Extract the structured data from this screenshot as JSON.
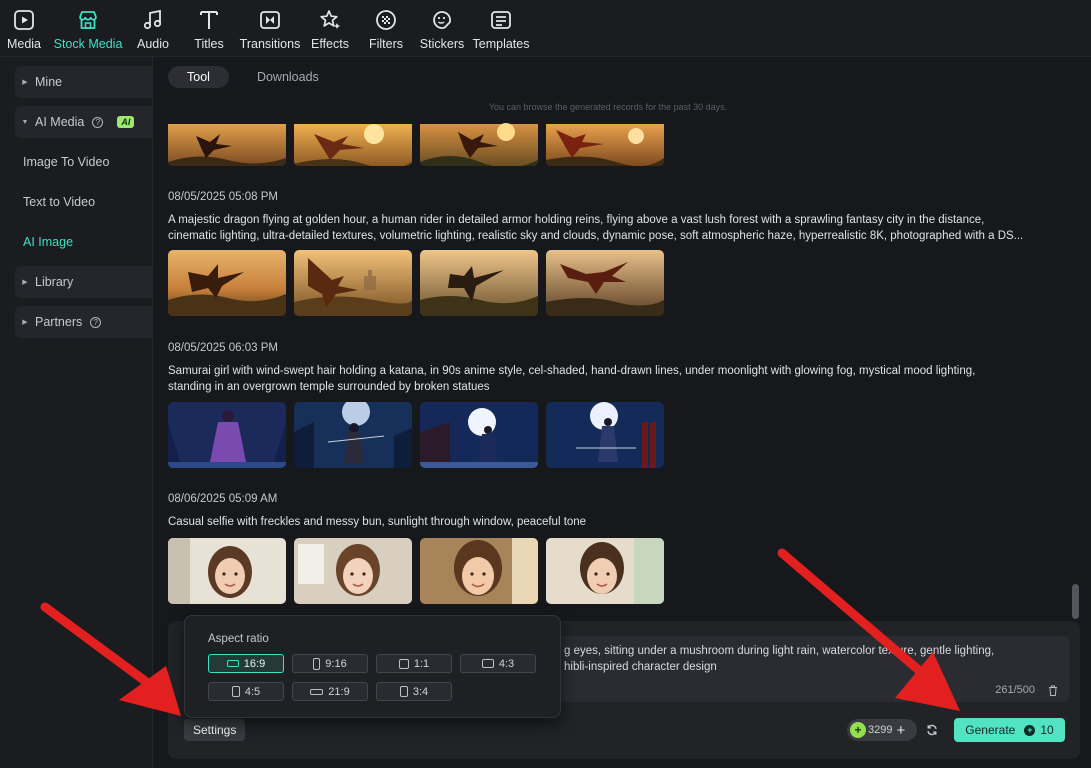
{
  "toolbar": {
    "items": [
      {
        "label": "Media",
        "icon": "media-icon"
      },
      {
        "label": "Stock Media",
        "icon": "stock-media-icon",
        "active": true
      },
      {
        "label": "Audio",
        "icon": "music-note-icon"
      },
      {
        "label": "Titles",
        "icon": "text-t-icon"
      },
      {
        "label": "Transitions",
        "icon": "transitions-icon"
      },
      {
        "label": "Effects",
        "icon": "effects-star-icon"
      },
      {
        "label": "Filters",
        "icon": "filters-icon"
      },
      {
        "label": "Stickers",
        "icon": "sticker-icon"
      },
      {
        "label": "Templates",
        "icon": "templates-icon"
      }
    ]
  },
  "sidebar": {
    "items": [
      {
        "label": "Mine"
      },
      {
        "label": "AI Media",
        "badge": "AI"
      },
      {
        "label": "Image To Video"
      },
      {
        "label": "Text to Video"
      },
      {
        "label": "AI Image"
      },
      {
        "label": "Library"
      },
      {
        "label": "Partners"
      }
    ]
  },
  "tabs": {
    "tool": "Tool",
    "downloads": "Downloads"
  },
  "hint": "You can browse the generated records for the past 30 days.",
  "records": [
    {
      "timestamp": "08/05/2025 05:08 PM",
      "prompt_line1": "A majestic dragon flying at golden hour, a human rider in detailed armor holding reins, flying above a vast lush forest with a sprawling fantasy city in the distance,",
      "prompt_line2": "cinematic lighting, ultra-detailed textures, volumetric lighting, realistic sky and clouds, dynamic pose, soft atmospheric haze, hyperrealistic 8K, photographed with a DS..."
    },
    {
      "timestamp": "08/05/2025 06:03 PM",
      "prompt_line1": "Samurai girl with wind-swept hair holding a katana, in 90s anime style, cel-shaded, hand-drawn lines, under moonlight with glowing fog, mystical mood lighting,",
      "prompt_line2": "standing in an overgrown temple surrounded by broken statues"
    },
    {
      "timestamp": "08/06/2025 05:09 AM",
      "prompt_line1": "Casual selfie with freckles and messy bun, sunlight through window, peaceful tone",
      "prompt_line2": ""
    }
  ],
  "composer": {
    "text_line1": "g eyes, sitting under a mushroom during light rain, watercolor texture, gentle lighting,",
    "text_line2": "hibli-inspired character design",
    "counter": "261/500",
    "settings": "Settings",
    "credits": "3299",
    "generate": "Generate",
    "generate_cost": "10"
  },
  "aspect": {
    "title": "Aspect ratio",
    "options": [
      "16:9",
      "9:16",
      "1:1",
      "4:3",
      "4:5",
      "21:9",
      "3:4"
    ],
    "selected": "16:9"
  },
  "colors": {
    "accent": "#3fe0c5",
    "generate": "#52e3c2",
    "arrow": "#e32020"
  }
}
